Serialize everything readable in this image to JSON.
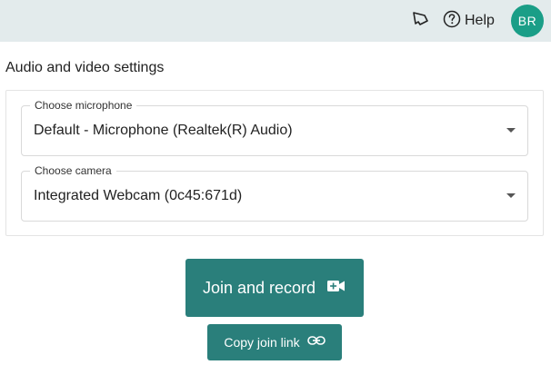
{
  "header": {
    "whatsnew_icon": "megaphone-icon",
    "help_icon": "question-circle-icon",
    "help_label": "Help",
    "avatar_initials": "BR",
    "background_color": "#e3ebec",
    "avatar_color": "#1a9e87"
  },
  "settings": {
    "title": "Audio and video settings",
    "microphone": {
      "legend": "Choose microphone",
      "value": "Default - Microphone (Realtek(R) Audio)"
    },
    "camera": {
      "legend": "Choose camera",
      "value": "Integrated Webcam (0c45:671d)"
    }
  },
  "actions": {
    "join_record_label": "Join and record",
    "join_record_icon": "video-plus-icon",
    "copy_link_label": "Copy join link",
    "copy_link_icon": "link-icon",
    "button_color": "#2a7f7b"
  }
}
